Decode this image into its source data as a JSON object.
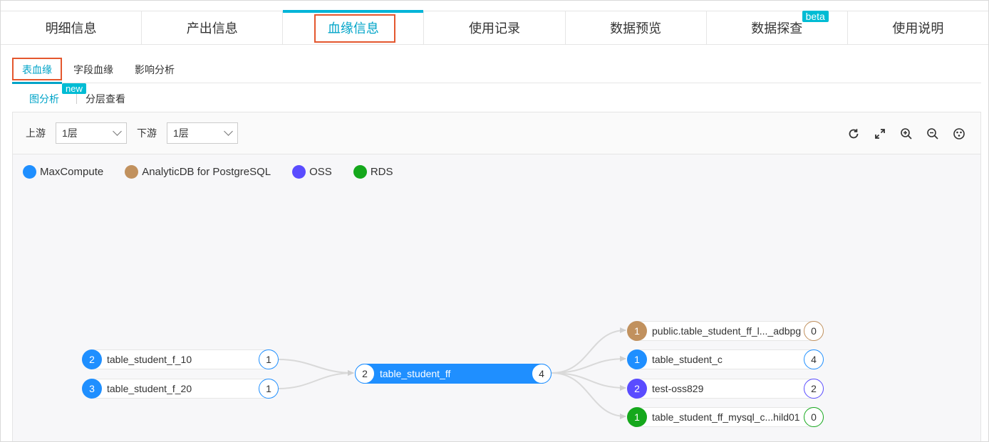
{
  "colors": {
    "maxcompute": "#1f8fff",
    "analyticdb": "#c1915e",
    "oss": "#5a4cff",
    "rds": "#15a81c",
    "accent": "#00a4c8",
    "highlight": "#e4572e"
  },
  "tabs": [
    {
      "label": "明细信息"
    },
    {
      "label": "产出信息"
    },
    {
      "label": "血缘信息",
      "active": true
    },
    {
      "label": "使用记录"
    },
    {
      "label": "数据预览"
    },
    {
      "label": "数据探查",
      "badge": "beta"
    },
    {
      "label": "使用说明"
    }
  ],
  "subtabs": [
    {
      "label": "表血缘",
      "active": true
    },
    {
      "label": "字段血缘"
    },
    {
      "label": "影响分析"
    }
  ],
  "viewmode": {
    "graph": "图分析",
    "graph_badge": "new",
    "layer": "分层查看"
  },
  "toolbar": {
    "upstream_label": "上游",
    "upstream_value": "1层",
    "downstream_label": "下游",
    "downstream_value": "1层",
    "tools": [
      "refresh-icon",
      "fullscreen-icon",
      "zoom-in-icon",
      "zoom-out-icon",
      "fit-view-icon"
    ]
  },
  "legend": [
    {
      "label": "MaxCompute",
      "color": "#1f8fff"
    },
    {
      "label": "AnalyticDB for PostgreSQL",
      "color": "#c1915e"
    },
    {
      "label": "OSS",
      "color": "#5a4cff"
    },
    {
      "label": "RDS",
      "color": "#15a81c"
    }
  ],
  "nodes": {
    "up1": {
      "level": "2",
      "name": "table_student_f_10",
      "count": "1",
      "color": "#1f8fff"
    },
    "up2": {
      "level": "3",
      "name": "table_student_f_20",
      "count": "1",
      "color": "#1f8fff"
    },
    "center": {
      "level": "2",
      "name": "table_student_ff",
      "count": "4",
      "color": "#1f8fff"
    },
    "down1": {
      "level": "1",
      "name": "public.table_student_ff_l..._adbpg",
      "count": "0",
      "color": "#c1915e"
    },
    "down2": {
      "level": "1",
      "name": "table_student_c",
      "count": "4",
      "color": "#1f8fff"
    },
    "down3": {
      "level": "2",
      "name": "test-oss829",
      "count": "2",
      "color": "#5a4cff"
    },
    "down4": {
      "level": "1",
      "name": "table_student_ff_mysql_c...hild01",
      "count": "0",
      "color": "#15a81c"
    }
  }
}
